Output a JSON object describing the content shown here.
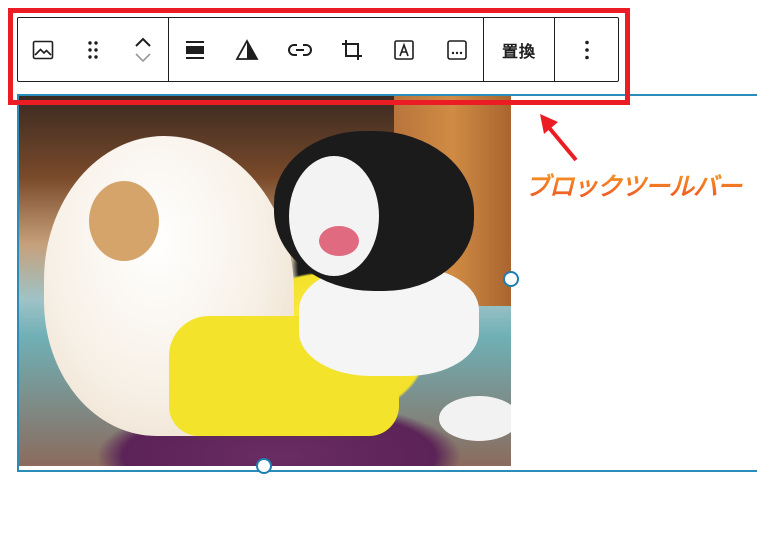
{
  "toolbar": {
    "groups": [
      {
        "items": [
          {
            "icon": "image-block-icon"
          },
          {
            "icon": "drag-handle-icon"
          },
          {
            "icon": "move-up-icon"
          },
          {
            "icon": "move-down-icon"
          }
        ]
      },
      {
        "items": [
          {
            "icon": "align-icon"
          },
          {
            "icon": "duotone-filter-icon"
          },
          {
            "icon": "link-icon"
          },
          {
            "icon": "crop-icon"
          },
          {
            "icon": "text-overlay-icon"
          },
          {
            "icon": "more-options-box-icon"
          }
        ]
      }
    ],
    "replace_label": "置換",
    "options_icon": "vertical-ellipsis-icon"
  },
  "image": {
    "subject": "photo"
  },
  "annotation": {
    "label": "ブロックツールバー",
    "highlight_color": "#ec1c24",
    "label_color": "#f57b22"
  },
  "colors": {
    "selection": "#2a8cb8",
    "toolbar_border": "#1e1e1e"
  }
}
